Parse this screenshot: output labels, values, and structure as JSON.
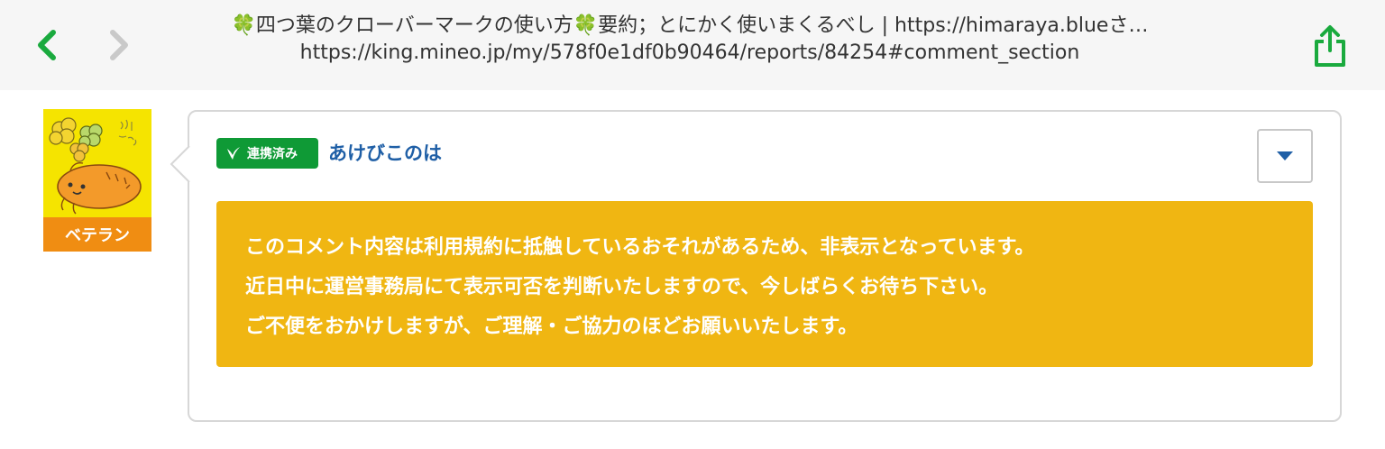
{
  "browser": {
    "back_icon": "chevron-left-icon",
    "forward_icon": "chevron-right-icon",
    "page_title": "🍀四つ葉のクローバーマークの使い方🍀要約；とにかく使いまくるべし | https://himaraya.blueさ…",
    "url": "https://king.mineo.jp/my/578f0e1df0b90464/reports/84254#comment_section",
    "share_icon": "share-icon",
    "accent_color": "#1aaa3e"
  },
  "comment": {
    "avatar_icon": "carrot-avatar-image",
    "rank_label": "ベテラン",
    "linked_badge_label": "連携済み",
    "username": "あけびこのは",
    "menu_icon": "caret-down-icon",
    "notice_lines": [
      "このコメント内容は利用規約に抵触しているおそれがあるため、非表示となっています。",
      "近日中に運営事務局にて表示可否を判断いたしますので、今しばらくお待ち下さい。",
      "ご不便をおかけしますが、ご理解・ご協力のほどお願いいたします。"
    ],
    "colors": {
      "rank_badge": "#f08d12",
      "linked_badge": "#0f9a36",
      "username": "#1f5fa6",
      "notice_bg": "#f0b612"
    }
  }
}
